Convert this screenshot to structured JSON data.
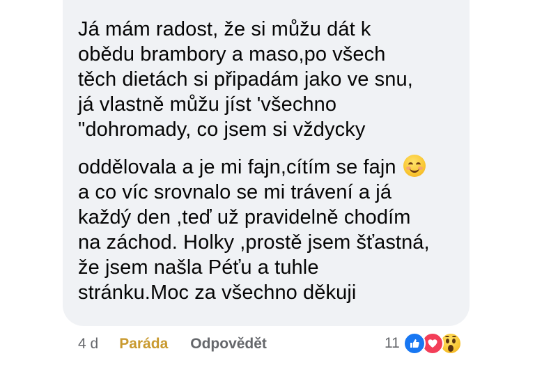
{
  "comment": {
    "lines": [
      "Já mám radost, že si můžu dát k",
      "obědu brambory a maso,po všech",
      "těch dietách si připadám jako ve snu,",
      "já vlastně můžu jíst 'všechno",
      "\"dohromady, co jsem si vždycky",
      "oddělovala a je mi fajn,cítím se fajn",
      "a co víc srovnalo se mi trávení a já",
      "každý den ,teď už pravidelně chodím",
      "na záchod. Holky ,prostě jsem šťastná,",
      "že jsem našla Péťu a tuhle",
      "stránku.Moc za všechno děkuji"
    ],
    "inline_emoji": "smiling-face"
  },
  "actions": {
    "time": "4 d",
    "like_label": "Paráda",
    "reply_label": "Odpovědět"
  },
  "reactions": {
    "count": "11",
    "icons": [
      "like-icon",
      "love-icon",
      "wow-icon"
    ]
  },
  "colors": {
    "bubble_bg": "#f0f2f5",
    "text": "#050505",
    "meta": "#65676b",
    "like_active": "#c99a30",
    "like_reaction": "#1877f2",
    "love_reaction": "#f33e58"
  }
}
